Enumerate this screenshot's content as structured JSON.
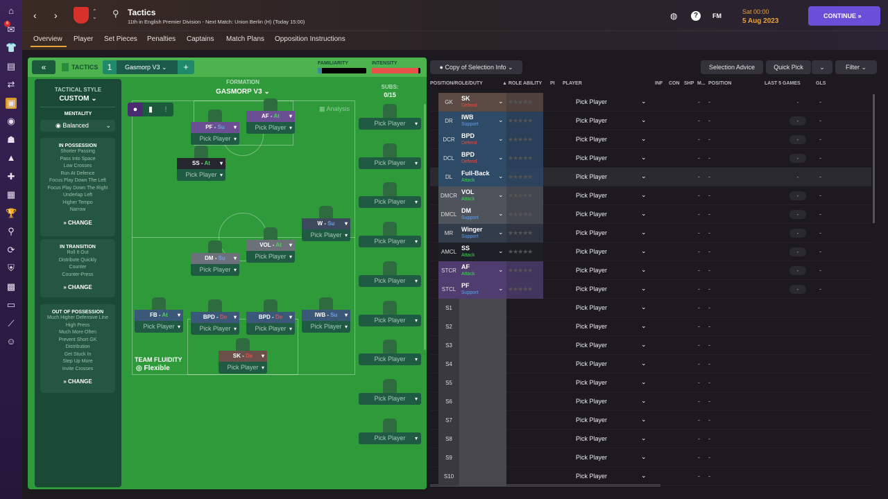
{
  "nav": {
    "icons": [
      "home-icon",
      "inbox-icon",
      "squad-icon",
      "notes-icon",
      "transfers-icon",
      "tactics-icon",
      "data-hub-icon",
      "staff-icon",
      "training-icon",
      "medical-icon",
      "schedule-icon",
      "competitions-icon",
      "scouting-icon",
      "recruitment-icon",
      "club-info-icon",
      "finances-icon",
      "development-icon",
      "dev-centre-icon",
      "manager-icon"
    ],
    "inbox_badge": "6"
  },
  "header": {
    "title": "Tactics",
    "subtitle": "11th in English Premier Division - Next Match: Union Berlin (H) (Today 15:00)",
    "fm": "FM",
    "day_time": "Sat 00:00",
    "date": "5 Aug 2023",
    "continue": "CONTINUE"
  },
  "tabs": [
    "Overview",
    "Player",
    "Set Pieces",
    "Penalties",
    "Captains",
    "Match Plans",
    "Opposition Instructions"
  ],
  "tactics_bar": {
    "label": "TACTICS",
    "slot": "1",
    "tactic_name": "Gasmorp V3",
    "familiarity": "FAMILIARITY",
    "intensity": "INTENSITY",
    "familiarity_level": 0.08,
    "intensity_level": 0.95
  },
  "style": {
    "title": "TACTICAL STYLE",
    "value": "CUSTOM",
    "mentality_label": "MENTALITY",
    "mentality": "Balanced",
    "change": "CHANGE",
    "in_possession": {
      "title": "IN POSSESSION",
      "items": [
        "Shorter Passing",
        "Pass Into Space",
        "Low Crosses",
        "Run At Defence",
        "Focus Play Down The Left",
        "Focus Play Down The Right",
        "Underlap Left",
        "Higher Tempo",
        "Narrow"
      ]
    },
    "in_transition": {
      "title": "IN TRANSITION",
      "items": [
        "Roll It Out",
        "Distribute Quickly",
        "Counter",
        "Counter-Press"
      ]
    },
    "out_of_possession": {
      "title": "OUT OF POSSESSION",
      "items": [
        "Much Higher Defensive Line",
        "High Press",
        "Much More Often",
        "Prevent Short GK",
        "Distribution",
        "Get Stuck In",
        "Step Up More",
        "Invite Crosses"
      ]
    }
  },
  "pitch": {
    "formation_label": "FORMATION",
    "formation": "GASMORP V3",
    "analysis": "Analysis",
    "fluidity_label": "TEAM FLUIDITY",
    "fluidity": "Flexible",
    "subs_label": "SUBS:",
    "subs_count": "0/15",
    "pick": "Pick Player",
    "cards": [
      {
        "role": "AF",
        "duty": "At",
        "color": "#6b4f93"
      },
      {
        "role": "PF",
        "duty": "Su",
        "color": "#6b4f93"
      },
      {
        "role": "SS",
        "duty": "At",
        "color": "#25262e"
      },
      {
        "role": "W",
        "duty": "Su",
        "color": "#3d4a5e"
      },
      {
        "role": "VOL",
        "duty": "At",
        "color": "#6c7078"
      },
      {
        "role": "DM",
        "duty": "Su",
        "color": "#6c7078"
      },
      {
        "role": "FB",
        "duty": "At",
        "color": "#3c5878"
      },
      {
        "role": "BPD",
        "duty": "De",
        "color": "#3c5878"
      },
      {
        "role": "BPD",
        "duty": "De",
        "color": "#3c5878"
      },
      {
        "role": "IWB",
        "duty": "Su",
        "color": "#3c5878"
      },
      {
        "role": "SK",
        "duty": "De",
        "color": "#6a5048"
      }
    ]
  },
  "table": {
    "copy_btn": "Copy of Selection Info",
    "selection_advice": "Selection Advice",
    "quick_pick": "Quick Pick",
    "filter": "Filter",
    "headers": [
      "POSITION/ROLE/DUTY",
      "ROLE ABILITY",
      "PI",
      "PLAYER",
      "INF",
      "CON",
      "SHP",
      "M...",
      "POSITION",
      "LAST 5 GAMES",
      "GLS"
    ],
    "stars": "★★★★★",
    "dash": "-",
    "rows": [
      {
        "pos": "GK",
        "role": "SK",
        "duty": "Defend",
        "bg": "#5b4a44",
        "dc": "#e0504a"
      },
      {
        "pos": "DR",
        "role": "IWB",
        "duty": "Support",
        "bg": "#2d4a66",
        "dc": "#6f9fe0"
      },
      {
        "pos": "DCR",
        "role": "BPD",
        "duty": "Defend",
        "bg": "#2d4a66",
        "dc": "#e0504a"
      },
      {
        "pos": "DCL",
        "role": "BPD",
        "duty": "Defend",
        "bg": "#2d4a66",
        "dc": "#e0504a"
      },
      {
        "pos": "DL",
        "role": "Full-Back",
        "duty": "Attack",
        "bg": "#2d4a66",
        "dc": "#4cd060"
      },
      {
        "pos": "DMCR",
        "role": "VOL",
        "duty": "Attack",
        "bg": "#4e535c",
        "dc": "#4cd060"
      },
      {
        "pos": "DMCL",
        "role": "DM",
        "duty": "Support",
        "bg": "#4e535c",
        "dc": "#6f9fe0"
      },
      {
        "pos": "MR",
        "role": "Winger",
        "duty": "Support",
        "bg": "#333c4a",
        "dc": "#6f9fe0"
      },
      {
        "pos": "AMCL",
        "role": "SS",
        "duty": "Attack",
        "bg": "#1e2027",
        "dc": "#4cd060"
      },
      {
        "pos": "STCR",
        "role": "AF",
        "duty": "Attack",
        "bg": "#4e3d6e",
        "dc": "#4cd060"
      },
      {
        "pos": "STCL",
        "role": "PF",
        "duty": "Support",
        "bg": "#4e3d6e",
        "dc": "#6f9fe0"
      },
      {
        "pos": "S1"
      },
      {
        "pos": "S2"
      },
      {
        "pos": "S3"
      },
      {
        "pos": "S4"
      },
      {
        "pos": "S5"
      },
      {
        "pos": "S6"
      },
      {
        "pos": "S7"
      },
      {
        "pos": "S8"
      },
      {
        "pos": "S9"
      },
      {
        "pos": "S10"
      }
    ]
  }
}
